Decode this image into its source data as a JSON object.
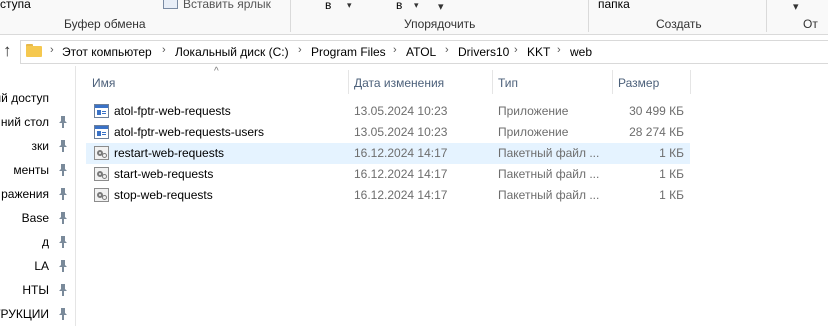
{
  "ribbon": {
    "access_label": "ступа",
    "clipboard_group": "Буфер обмена",
    "paste_shortcut_label": "Вставить ярлык",
    "move_to_label": "в",
    "copy_to_label": "в",
    "organize_group": "Упорядочить",
    "new_folder_label": "папка",
    "create_group": "Создать",
    "open_group_partial": "От"
  },
  "address": {
    "up_icon": "arrow-up-icon",
    "folder_icon": "folder-icon",
    "crumbs": [
      "Этот компьютер",
      "Локальный диск (C:)",
      "Program Files",
      "ATOL",
      "Drivers10",
      "KKT",
      "web"
    ]
  },
  "nav": {
    "items": [
      {
        "label": "ый доступ",
        "pinned": false
      },
      {
        "label": "ний стол",
        "pinned": true
      },
      {
        "label": "зки",
        "pinned": true
      },
      {
        "label": "менты",
        "pinned": true
      },
      {
        "label": "ражения",
        "pinned": true
      },
      {
        "label": "Base",
        "pinned": true
      },
      {
        "label": "д",
        "pinned": true
      },
      {
        "label": "LA",
        "pinned": true
      },
      {
        "label": "НТЫ",
        "pinned": true
      },
      {
        "label": "ТРУКЦИИ",
        "pinned": true
      }
    ]
  },
  "columns": {
    "name": "Имя",
    "date": "Дата изменения",
    "type": "Тип",
    "size": "Размер"
  },
  "files": [
    {
      "name": "atol-fptr-web-requests",
      "date": "13.05.2024 10:23",
      "type": "Приложение",
      "size": "30 499 КБ",
      "icon": "application-icon",
      "highlighted": false
    },
    {
      "name": "atol-fptr-web-requests-users",
      "date": "13.05.2024 10:23",
      "type": "Приложение",
      "size": "28 274 КБ",
      "icon": "application-icon",
      "highlighted": false
    },
    {
      "name": "restart-web-requests",
      "date": "16.12.2024 14:17",
      "type": "Пакетный файл ...",
      "size": "1 КБ",
      "icon": "batch-file-icon",
      "highlighted": true
    },
    {
      "name": "start-web-requests",
      "date": "16.12.2024 14:17",
      "type": "Пакетный файл ...",
      "size": "1 КБ",
      "icon": "batch-file-icon",
      "highlighted": false
    },
    {
      "name": "stop-web-requests",
      "date": "16.12.2024 14:17",
      "type": "Пакетный файл ...",
      "size": "1 КБ",
      "icon": "batch-file-icon",
      "highlighted": false
    }
  ],
  "colors": {
    "hover_row": "#e5f3ff",
    "column_header_text": "#4c607a",
    "secondary_text": "#6d6d6d",
    "folder": "#f5c84f"
  }
}
